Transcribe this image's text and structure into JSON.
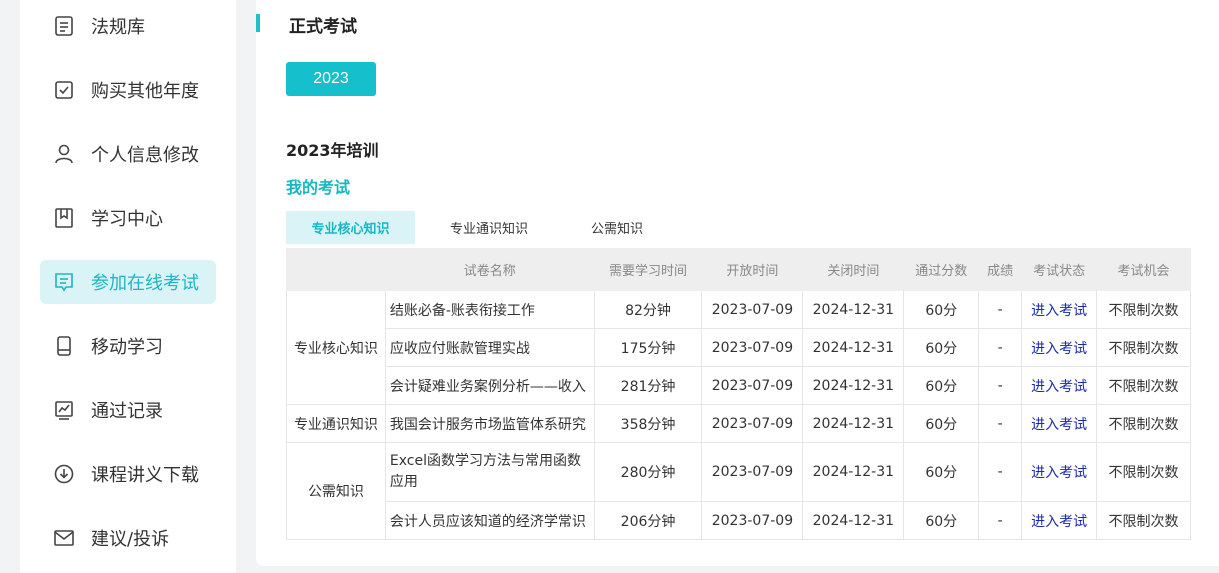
{
  "sidebar": {
    "items": [
      {
        "label": "法规库",
        "icon": "document-icon"
      },
      {
        "label": "购买其他年度",
        "icon": "checkbox-icon"
      },
      {
        "label": "个人信息修改",
        "icon": "user-icon"
      },
      {
        "label": "学习中心",
        "icon": "bookmark-icon"
      },
      {
        "label": "参加在线考试",
        "icon": "exam-icon",
        "active": true
      },
      {
        "label": "移动学习",
        "icon": "mobile-icon"
      },
      {
        "label": "通过记录",
        "icon": "chart-icon"
      },
      {
        "label": "课程讲义下载",
        "icon": "download-icon"
      },
      {
        "label": "建议/投诉",
        "icon": "mail-icon"
      }
    ]
  },
  "main": {
    "page_title": "正式考试",
    "year_button": "2023",
    "section_title": "2023年培训",
    "exam_title": "我的考试",
    "tabs": [
      "专业核心知识",
      "专业通识知识",
      "公需知识"
    ],
    "columns": [
      "试卷名称",
      "需要学习时间",
      "开放时间",
      "关闭时间",
      "通过分数",
      "成绩",
      "考试状态",
      "考试机会"
    ],
    "groups": [
      {
        "category": "专业核心知识",
        "rows": [
          {
            "paper": "结账必备-账表衔接工作",
            "time": "82分钟",
            "open": "2023-07-09",
            "close": "2024-12-31",
            "pass": "60分",
            "score": "-",
            "status": "进入考试",
            "chance": "不限制次数"
          },
          {
            "paper": "应收应付账款管理实战",
            "time": "175分钟",
            "open": "2023-07-09",
            "close": "2024-12-31",
            "pass": "60分",
            "score": "-",
            "status": "进入考试",
            "chance": "不限制次数"
          },
          {
            "paper": "会计疑难业务案例分析——收入",
            "time": "281分钟",
            "open": "2023-07-09",
            "close": "2024-12-31",
            "pass": "60分",
            "score": "-",
            "status": "进入考试",
            "chance": "不限制次数"
          }
        ]
      },
      {
        "category": "专业通识知识",
        "rows": [
          {
            "paper": "我国会计服务市场监管体系研究",
            "time": "358分钟",
            "open": "2023-07-09",
            "close": "2024-12-31",
            "pass": "60分",
            "score": "-",
            "status": "进入考试",
            "chance": "不限制次数"
          }
        ]
      },
      {
        "category": "公需知识",
        "rows": [
          {
            "paper": "Excel函数学习方法与常用函数应用",
            "time": "280分钟",
            "open": "2023-07-09",
            "close": "2024-12-31",
            "pass": "60分",
            "score": "-",
            "status": "进入考试",
            "chance": "不限制次数"
          },
          {
            "paper": "会计人员应该知道的经济学常识",
            "time": "206分钟",
            "open": "2023-07-09",
            "close": "2024-12-31",
            "pass": "60分",
            "score": "-",
            "status": "进入考试",
            "chance": "不限制次数"
          }
        ]
      }
    ]
  },
  "colors": {
    "accent": "#16bfcc",
    "active_bg": "#daf3f6",
    "link": "#1a2bb0"
  }
}
